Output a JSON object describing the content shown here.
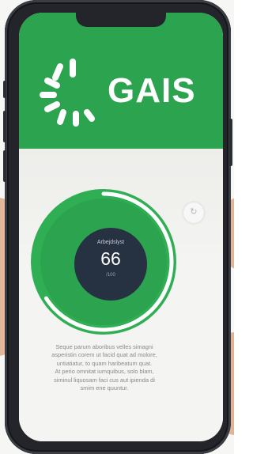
{
  "app": {
    "logo_text": "GAIS",
    "brand_color": "#2ca44f"
  },
  "gauge": {
    "label": "Arbejdslyst",
    "value": "66",
    "sub_label": "/100",
    "progress_fraction": 0.66,
    "ring_color": "#2ca44f",
    "center_color": "#263142"
  },
  "side_control": {
    "icon": "refresh-icon",
    "glyph": "↻"
  },
  "description": {
    "lines": [
      "Seque parum aboribus velles simagni",
      "asperistin corem ut facid quat ad molore,",
      "untiatiatur, to quam haribeatum quat.",
      "At perio omnitat iumquibus, solo blam,",
      "siminul liquosam faci cus aut ipienda di",
      "smim ene quuntur."
    ]
  }
}
